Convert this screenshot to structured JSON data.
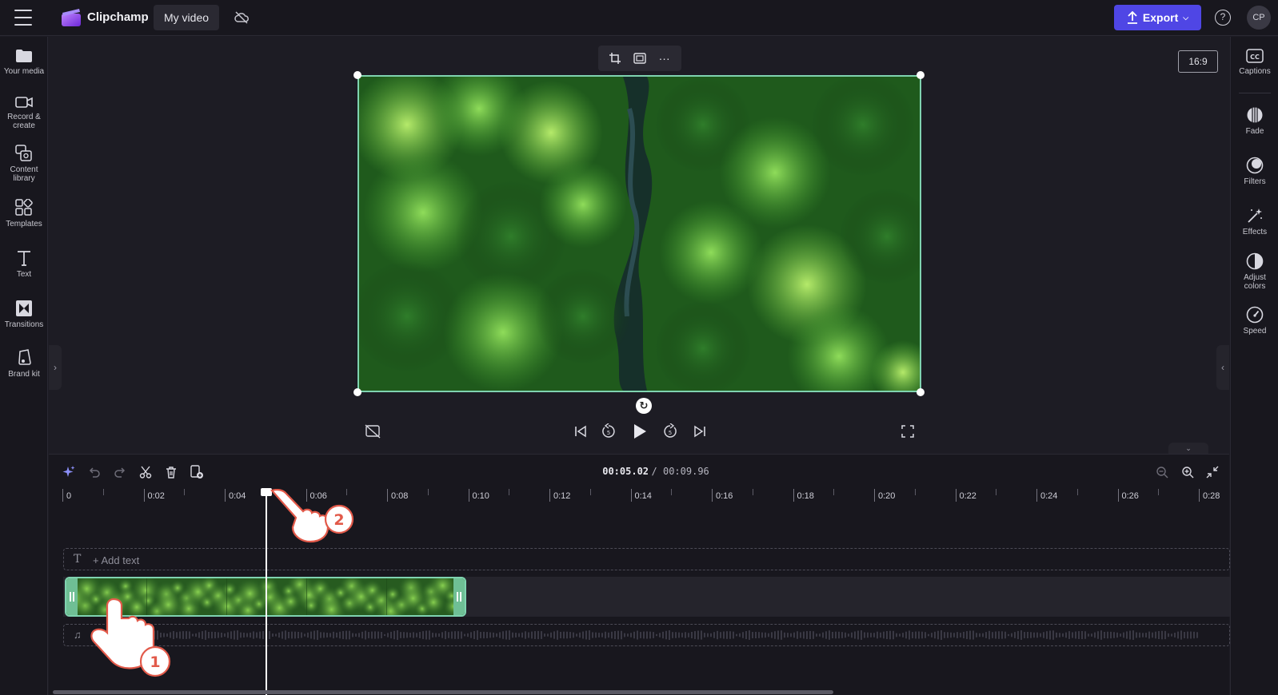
{
  "app": {
    "name": "Clipchamp",
    "project_title": "My video"
  },
  "header": {
    "export_label": "Export",
    "help_icon": "?",
    "avatar_initials": "CP"
  },
  "left_sidebar": {
    "items": [
      {
        "label": "Your media",
        "icon": "folder-icon"
      },
      {
        "label": "Record &",
        "label2": "create",
        "icon": "camera-icon"
      },
      {
        "label": "Content",
        "label2": "library",
        "icon": "library-icon"
      },
      {
        "label": "Templates",
        "icon": "templates-icon"
      },
      {
        "label": "Text",
        "icon": "text-icon"
      },
      {
        "label": "Transitions",
        "icon": "transitions-icon"
      },
      {
        "label": "Brand kit",
        "icon": "brand-kit-icon"
      }
    ]
  },
  "right_sidebar": {
    "items": [
      {
        "label": "Captions",
        "icon": "captions-icon"
      },
      {
        "label": "Fade",
        "icon": "fade-icon"
      },
      {
        "label": "Filters",
        "icon": "filters-icon"
      },
      {
        "label": "Effects",
        "icon": "effects-icon"
      },
      {
        "label": "Adjust",
        "label2": "colors",
        "icon": "adjust-colors-icon"
      },
      {
        "label": "Speed",
        "icon": "speed-icon"
      }
    ]
  },
  "preview": {
    "aspect_ratio": "16:9",
    "more_label": "···"
  },
  "timeline": {
    "current_time": "00:05.02",
    "total_time": "/ 00:09.96",
    "ruler_labels": [
      "0",
      "0:02",
      "0:04",
      "0:06",
      "0:08",
      "0:10",
      "0:12",
      "0:14",
      "0:16",
      "0:18",
      "0:20",
      "0:22",
      "0:24",
      "0:26",
      "0:28"
    ],
    "add_text_label": "+ Add text",
    "playhead_seconds": 5.02
  },
  "colors": {
    "accent": "#4f46e5",
    "selection": "#7fd3b0",
    "background": "#1d1c24",
    "panel": "#18171e"
  }
}
